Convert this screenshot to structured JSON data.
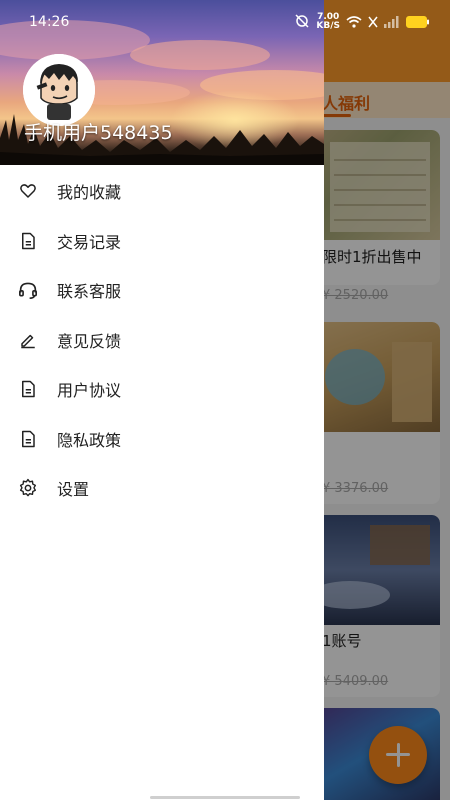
{
  "status_bar": {
    "time": "14:26",
    "net_speed_value": "7.00",
    "net_speed_unit": "KB/S"
  },
  "drawer": {
    "username": "手机用户548435",
    "menu": [
      {
        "label": "我的收藏",
        "icon": "heart-icon"
      },
      {
        "label": "交易记录",
        "icon": "document-icon"
      },
      {
        "label": "联系客服",
        "icon": "headset-icon"
      },
      {
        "label": "意见反馈",
        "icon": "pencil-icon"
      },
      {
        "label": "用户协议",
        "icon": "document-icon"
      },
      {
        "label": "隐私政策",
        "icon": "document-icon"
      },
      {
        "label": "设置",
        "icon": "gear-icon"
      }
    ]
  },
  "background": {
    "tab_label": "人福利",
    "accent_color": "#ff9c2a",
    "cards": [
      {
        "title": "限时1折出售中",
        "price": "¥ 2520.00"
      },
      {
        "title": "",
        "price": "¥ 3376.00"
      },
      {
        "title": "1账号",
        "price": "¥ 5409.00"
      },
      {
        "title": "",
        "price": ""
      }
    ],
    "fab_icon": "plus-icon"
  }
}
